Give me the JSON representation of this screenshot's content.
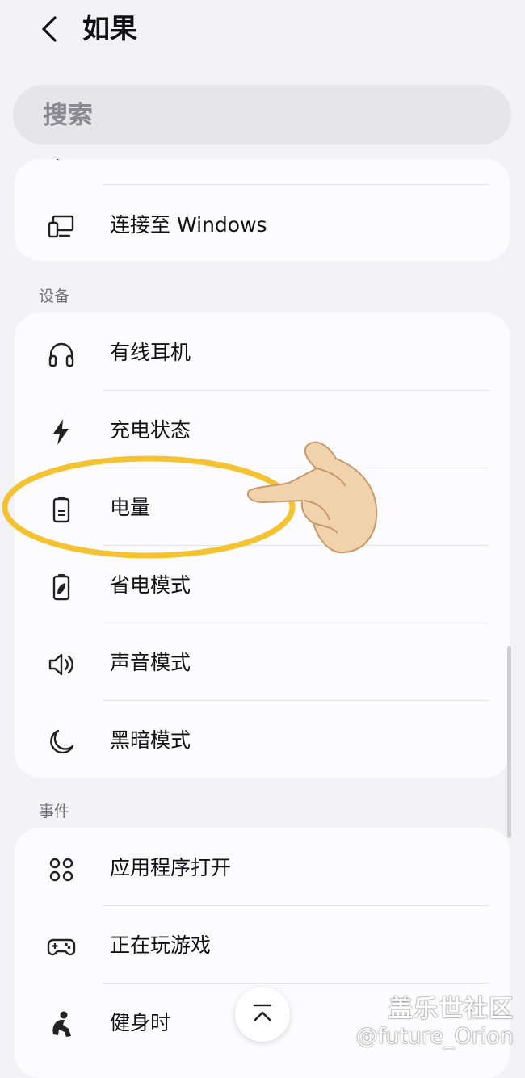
{
  "header": {
    "title": "如果"
  },
  "search": {
    "placeholder": "搜索"
  },
  "top_card": {
    "items": [
      {
        "label": "连接至 Windows",
        "icon": "display-phone-icon"
      }
    ]
  },
  "sections": {
    "devices": {
      "title": "设备",
      "items": [
        {
          "label": "有线耳机",
          "icon": "headphones-icon"
        },
        {
          "label": "充电状态",
          "icon": "lightning-icon"
        },
        {
          "label": "电量",
          "icon": "battery-icon"
        },
        {
          "label": "省电模式",
          "icon": "battery-leaf-icon"
        },
        {
          "label": "声音模式",
          "icon": "speaker-icon"
        },
        {
          "label": "黑暗模式",
          "icon": "moon-icon"
        }
      ]
    },
    "events": {
      "title": "事件",
      "items": [
        {
          "label": "应用程序打开",
          "icon": "apps-grid-icon"
        },
        {
          "label": "正在玩游戏",
          "icon": "gamepad-icon"
        },
        {
          "label": "健身时",
          "icon": "fitness-icon"
        }
      ]
    }
  },
  "annotation": {
    "highlight_color": "#f5c331"
  },
  "watermark": {
    "title": "盖乐世社区",
    "handle": "@future_Orion"
  }
}
